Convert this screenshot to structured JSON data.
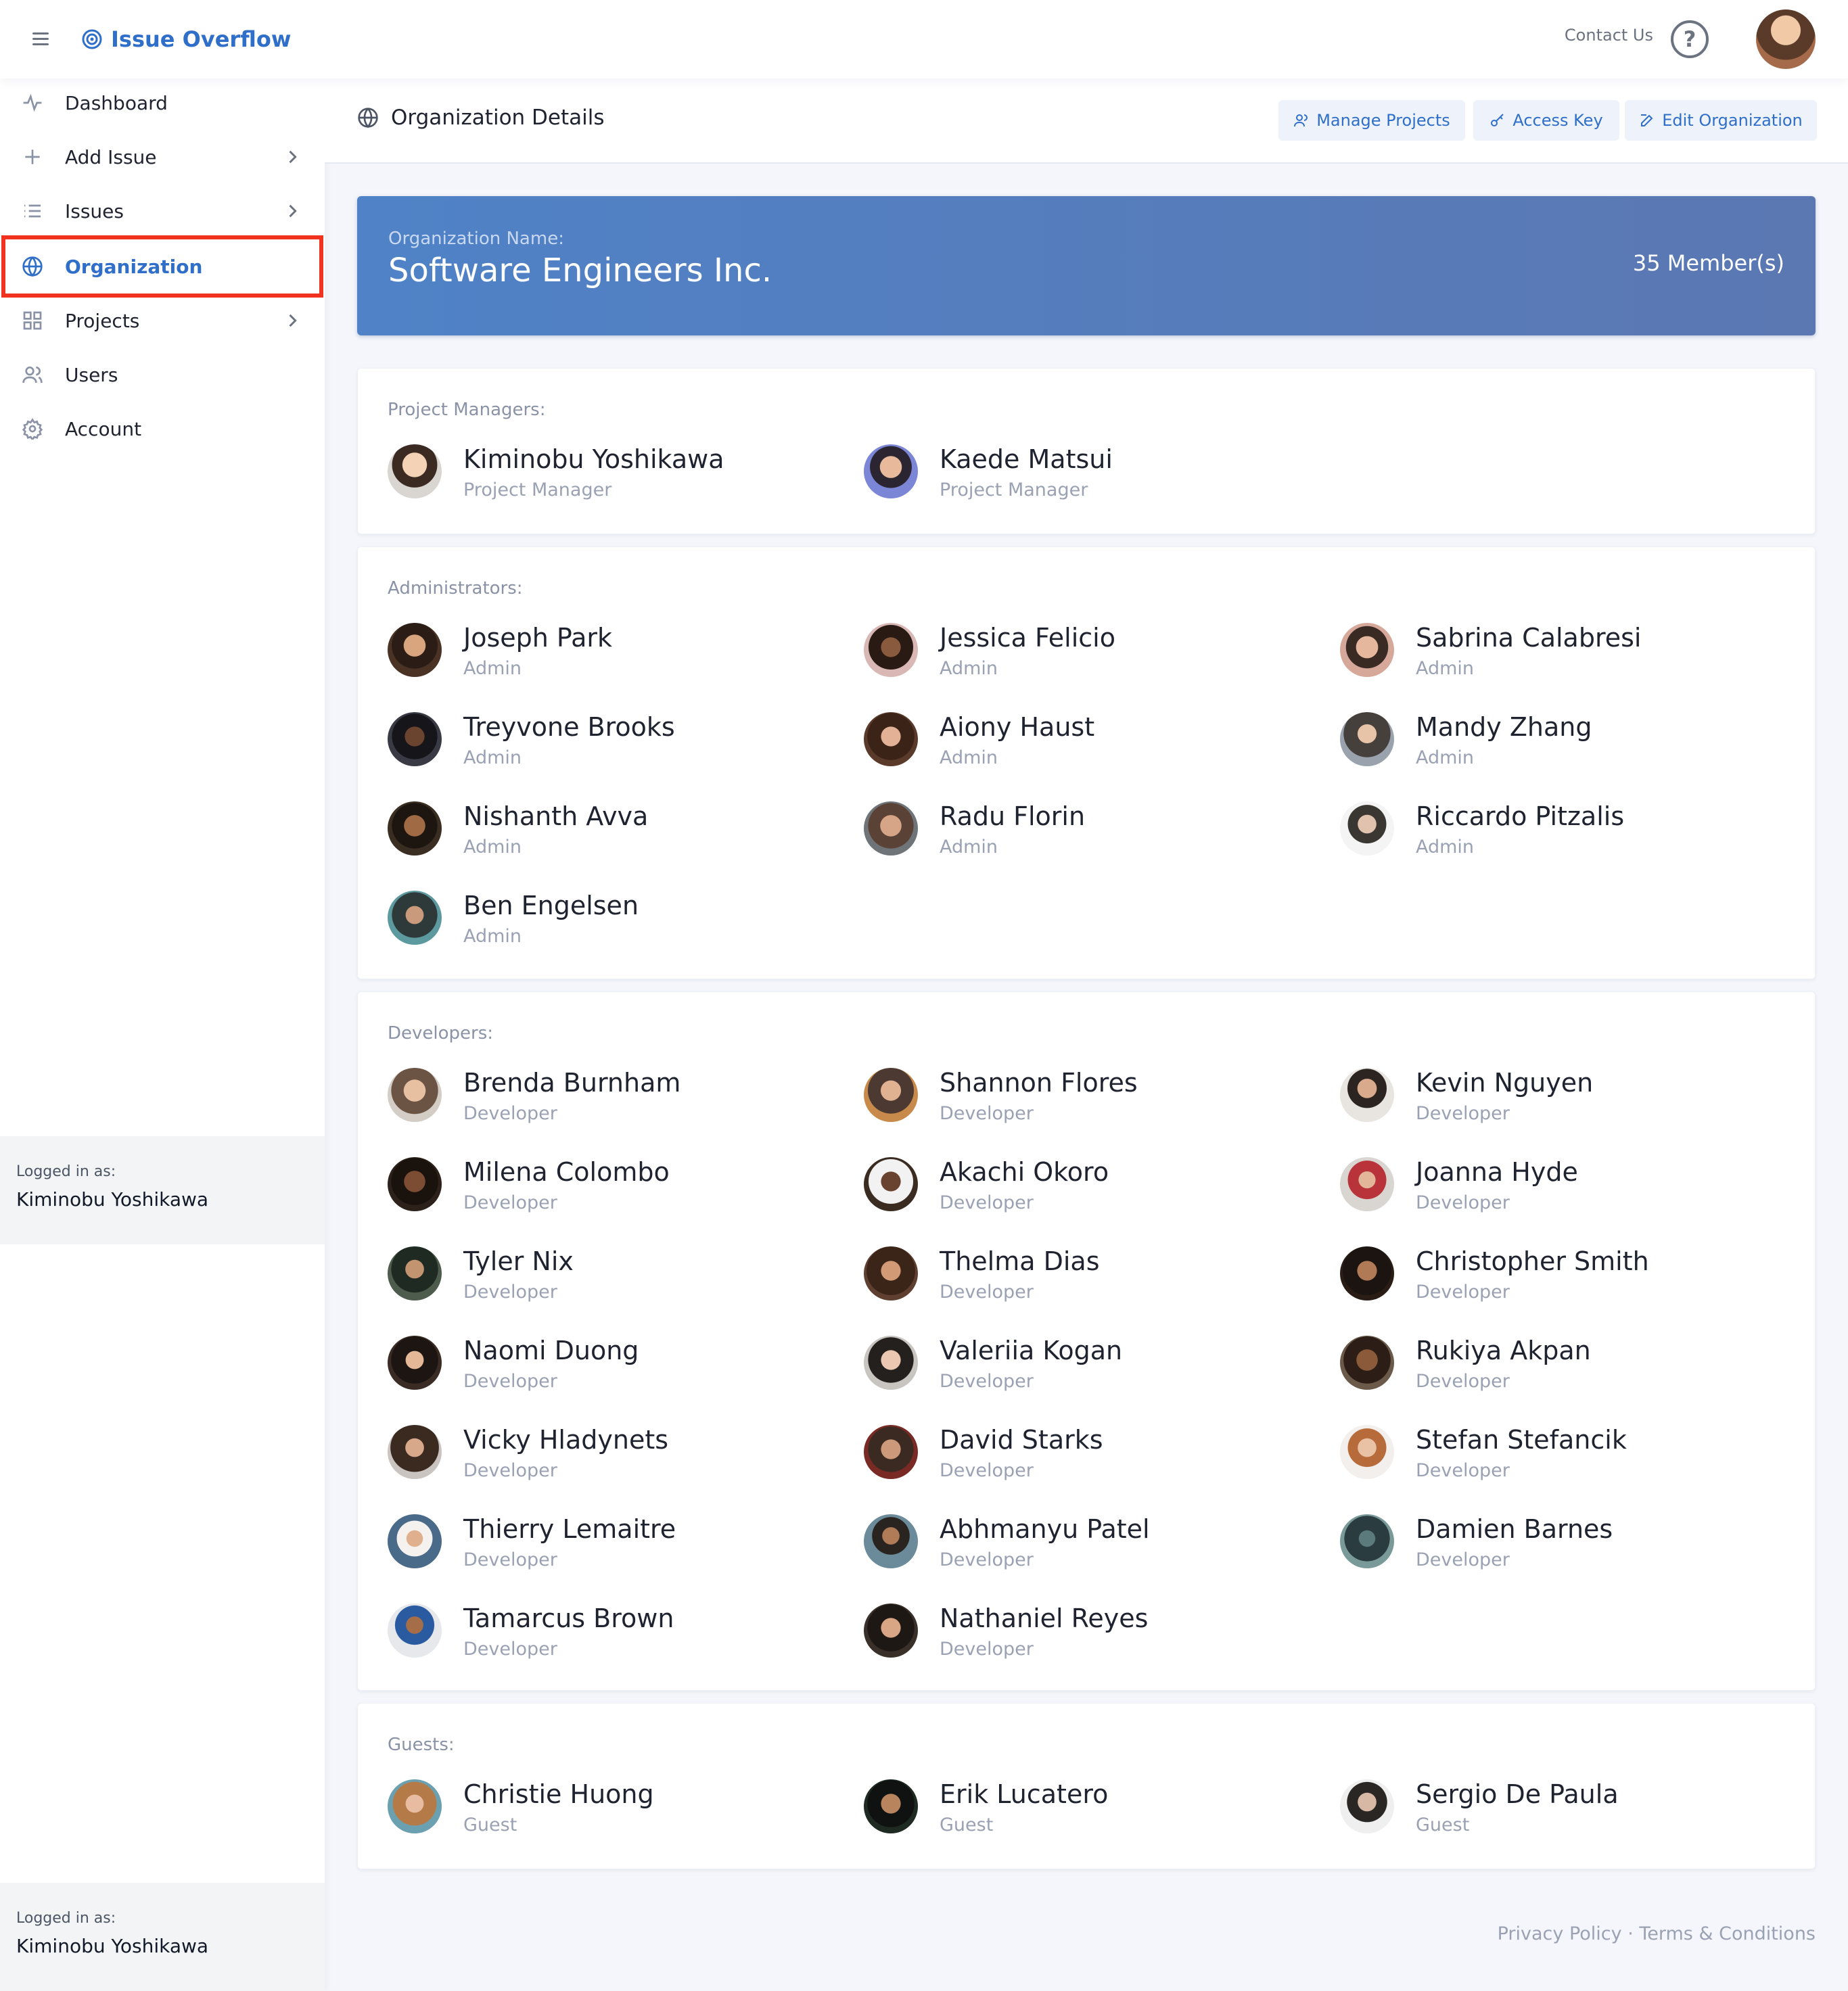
{
  "topbar": {
    "brand": "Issue Overflow",
    "contact": "Contact Us",
    "help": "?"
  },
  "sidebar": {
    "items": [
      {
        "label": "Dashboard",
        "icon": "activity-icon",
        "chevron": false
      },
      {
        "label": "Add Issue",
        "icon": "plus-icon",
        "chevron": true
      },
      {
        "label": "Issues",
        "icon": "list-icon",
        "chevron": true
      },
      {
        "label": "Organization",
        "icon": "globe-icon",
        "chevron": false,
        "active": true
      },
      {
        "label": "Projects",
        "icon": "grid-icon",
        "chevron": true
      },
      {
        "label": "Users",
        "icon": "users-icon",
        "chevron": false
      },
      {
        "label": "Account",
        "icon": "settings-icon",
        "chevron": false
      }
    ],
    "logged_label": "Logged in as:",
    "logged_user": "Kiminobu Yoshikawa"
  },
  "header": {
    "title": "Organization Details",
    "buttons": {
      "manage_projects": "Manage Projects",
      "access_key": "Access Key",
      "edit_organization": "Edit Organization"
    }
  },
  "organization": {
    "name_label": "Organization Name:",
    "name": "Software Engineers Inc.",
    "members": "35 Member(s)"
  },
  "sections": {
    "managers": {
      "title": "Project Managers:",
      "people": [
        {
          "name": "Kiminobu Yoshikawa",
          "role": "Project Manager"
        },
        {
          "name": "Kaede Matsui",
          "role": "Project Manager"
        }
      ]
    },
    "admins": {
      "title": "Administrators:",
      "people": [
        {
          "name": "Joseph Park",
          "role": "Admin"
        },
        {
          "name": "Jessica Felicio",
          "role": "Admin"
        },
        {
          "name": "Sabrina Calabresi",
          "role": "Admin"
        },
        {
          "name": "Treyvone Brooks",
          "role": "Admin"
        },
        {
          "name": "Aiony Haust",
          "role": "Admin"
        },
        {
          "name": "Mandy Zhang",
          "role": "Admin"
        },
        {
          "name": "Nishanth Avva",
          "role": "Admin"
        },
        {
          "name": "Radu Florin",
          "role": "Admin"
        },
        {
          "name": "Riccardo Pitzalis",
          "role": "Admin"
        },
        {
          "name": "Ben Engelsen",
          "role": "Admin"
        }
      ]
    },
    "developers": {
      "title": "Developers:",
      "people": [
        {
          "name": "Brenda Burnham",
          "role": "Developer"
        },
        {
          "name": "Shannon Flores",
          "role": "Developer"
        },
        {
          "name": "Kevin Nguyen",
          "role": "Developer"
        },
        {
          "name": "Milena Colombo",
          "role": "Developer"
        },
        {
          "name": "Akachi Okoro",
          "role": "Developer"
        },
        {
          "name": "Joanna Hyde",
          "role": "Developer"
        },
        {
          "name": "Tyler Nix",
          "role": "Developer"
        },
        {
          "name": "Thelma Dias",
          "role": "Developer"
        },
        {
          "name": "Christopher Smith",
          "role": "Developer"
        },
        {
          "name": "Naomi Duong",
          "role": "Developer"
        },
        {
          "name": "Valeriia Kogan",
          "role": "Developer"
        },
        {
          "name": "Rukiya Akpan",
          "role": "Developer"
        },
        {
          "name": "Vicky Hladynets",
          "role": "Developer"
        },
        {
          "name": "David Starks",
          "role": "Developer"
        },
        {
          "name": "Stefan Stefancik",
          "role": "Developer"
        },
        {
          "name": "Thierry Lemaitre",
          "role": "Developer"
        },
        {
          "name": "Abhmanyu Patel",
          "role": "Developer"
        },
        {
          "name": "Damien Barnes",
          "role": "Developer"
        },
        {
          "name": "Tamarcus Brown",
          "role": "Developer"
        },
        {
          "name": "Nathaniel Reyes",
          "role": "Developer"
        }
      ]
    },
    "guests": {
      "title": "Guests:",
      "people": [
        {
          "name": "Christie Huong",
          "role": "Guest"
        },
        {
          "name": "Erik Lucatero",
          "role": "Guest"
        },
        {
          "name": "Sergio De Paula",
          "role": "Guest"
        }
      ]
    }
  },
  "footer": {
    "text": "Privacy Policy · Terms & Conditions"
  },
  "colors": {
    "accent": "#2f6fc9",
    "banner_start": "#4f82c7",
    "banner_end": "#5b78b2",
    "highlight_border": "#f0321f"
  }
}
